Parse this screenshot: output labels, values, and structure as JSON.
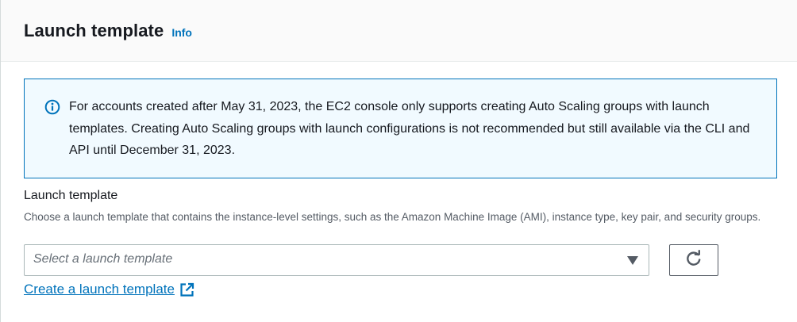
{
  "header": {
    "title": "Launch template",
    "info_label": "Info"
  },
  "alert": {
    "icon": "info-circle-icon",
    "text": "For accounts created after May 31, 2023, the EC2 console only supports creating Auto Scaling groups with launch templates. Creating Auto Scaling groups with launch configurations is not recommended but still available via the CLI and API until December 31, 2023."
  },
  "field": {
    "label": "Launch template",
    "description": "Choose a launch template that contains the instance-level settings, such as the Amazon Machine Image (AMI), instance type, key pair, and security groups.",
    "select_placeholder": "Select a launch template",
    "select_icon": "caret-down-icon",
    "refresh_icon": "refresh-icon"
  },
  "create_link": {
    "label": "Create a launch template",
    "icon": "external-link-icon"
  },
  "colors": {
    "accent": "#0073bb",
    "alert_background": "#f1faff",
    "text": "#16191f",
    "secondary_text": "#545b64"
  }
}
